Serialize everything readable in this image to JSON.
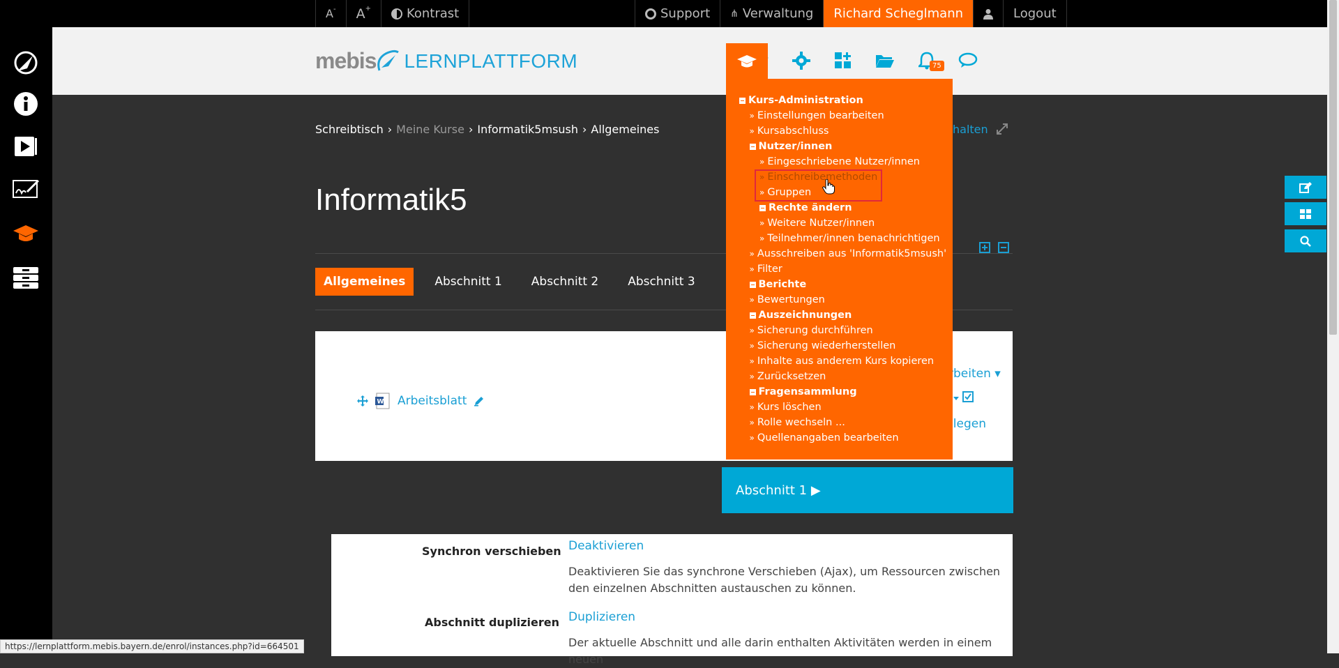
{
  "topbar": {
    "font_small": "A",
    "font_large": "A",
    "contrast": "Kontrast",
    "support": "Support",
    "admin": "Verwaltung",
    "user": "Richard Scheglmann",
    "logout": "Logout"
  },
  "header": {
    "logo_brand": "mebis",
    "logo_text": "LERNPLATTFORM",
    "notification_count": "75"
  },
  "breadcrumb": {
    "items": [
      "Schreibtisch",
      "Meine Kurse",
      "Informatik5msush",
      "Allgemeines"
    ],
    "separator": "›",
    "right_partial": "halten"
  },
  "course": {
    "title": "Informatik5"
  },
  "tabs": [
    "Allgemeines",
    "Abschnitt 1",
    "Abschnitt 2",
    "Abschnitt 3"
  ],
  "section": {
    "activity_label": "Arbeitsblatt",
    "partial_edit": "rbeiten",
    "partial_create": "nlegen"
  },
  "next_section": {
    "label": "Abschnitt 1 ▶"
  },
  "settings": {
    "rows": [
      {
        "label": "Synchron verschieben",
        "link": "Deaktivieren",
        "desc": "Deaktivieren Sie das synchrone Verschieben (Ajax), um Ressourcen zwischen den einzelnen Abschnitten austauschen zu können."
      },
      {
        "label": "Abschnitt duplizieren",
        "link": "Duplizieren",
        "desc": "Der aktuelle Abschnitt und alle darin enthalten Aktivitäten werden in einem neuen"
      }
    ]
  },
  "admin_menu": {
    "items": [
      {
        "label": "Kurs-Administration",
        "type": "header"
      },
      {
        "label": "Einstellungen bearbeiten",
        "type": "link"
      },
      {
        "label": "Kursabschluss",
        "type": "link"
      },
      {
        "label": "Nutzer/innen",
        "type": "header"
      },
      {
        "label": "Eingeschriebene Nutzer/innen",
        "type": "link"
      },
      {
        "label": "Einschreibemethoden",
        "type": "link-hover"
      },
      {
        "label": "Gruppen",
        "type": "link"
      },
      {
        "label": "Rechte ändern",
        "type": "header"
      },
      {
        "label": "Weitere Nutzer/innen",
        "type": "link"
      },
      {
        "label": "Teilnehmer/innen benachrichtigen",
        "type": "link"
      },
      {
        "label": "Ausschreiben aus 'Informatik5msush'",
        "type": "link"
      },
      {
        "label": "Filter",
        "type": "link"
      },
      {
        "label": "Berichte",
        "type": "header"
      },
      {
        "label": "Bewertungen",
        "type": "link"
      },
      {
        "label": "Auszeichnungen",
        "type": "header"
      },
      {
        "label": "Sicherung durchführen",
        "type": "link"
      },
      {
        "label": "Sicherung wiederherstellen",
        "type": "link"
      },
      {
        "label": "Inhalte aus anderem Kurs kopieren",
        "type": "link"
      },
      {
        "label": "Zurücksetzen",
        "type": "link"
      },
      {
        "label": "Fragensammlung",
        "type": "header"
      },
      {
        "label": "Kurs löschen",
        "type": "link"
      },
      {
        "label": "Rolle wechseln ...",
        "type": "link"
      },
      {
        "label": "Quellenangaben bearbeiten",
        "type": "link"
      }
    ]
  },
  "status_url": "https://lernplattform.mebis.bayern.de/enrol/instances.php?id=664501",
  "colors": {
    "accent_orange": "#ff6600",
    "accent_blue": "#00a8d6",
    "link_blue": "#1a9fd4"
  }
}
